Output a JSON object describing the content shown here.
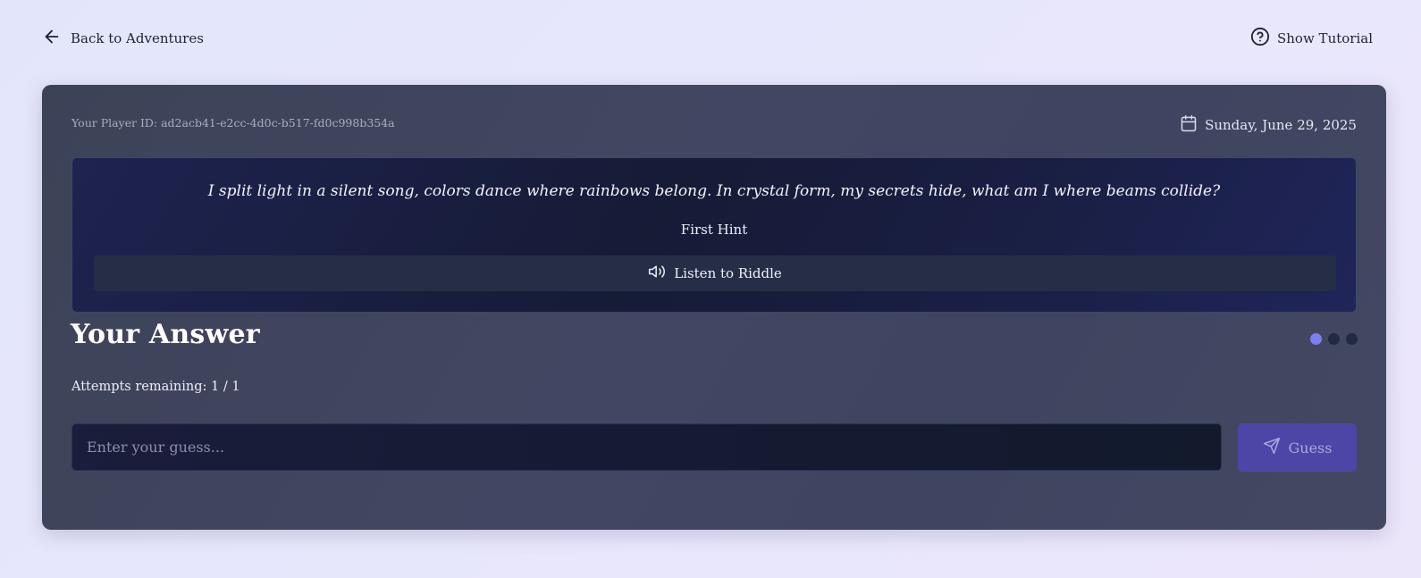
{
  "nav": {
    "back_label": "Back to Adventures",
    "tutorial_label": "Show Tutorial"
  },
  "card": {
    "player_id": "Your Player ID: ad2acb41-e2cc-4d0c-b517-fd0c998b354a",
    "date": "Sunday, June 29, 2025"
  },
  "riddle": {
    "text": "I split light in a silent song, colors dance where rainbows belong. In crystal form, my secrets hide, what am I where beams collide?",
    "hint_label": "First Hint",
    "listen_label": "Listen to Riddle"
  },
  "answer": {
    "title": "Your Answer",
    "attempts_text": "Attempts remaining: 1 / 1",
    "progress_dots": {
      "total": 3,
      "active": 1
    },
    "input_placeholder": "Enter your guess...",
    "input_value": "",
    "guess_label": "Guess"
  },
  "colors": {
    "accent": "#7c7ff0",
    "button": "#4c47a7",
    "card_bg": "#404560",
    "riddle_bg": "#1a1f45"
  },
  "icons": {
    "back": "arrow-left-icon",
    "tutorial": "help-circle-icon",
    "date": "calendar-icon",
    "listen": "speaker-icon",
    "guess": "send-icon"
  }
}
